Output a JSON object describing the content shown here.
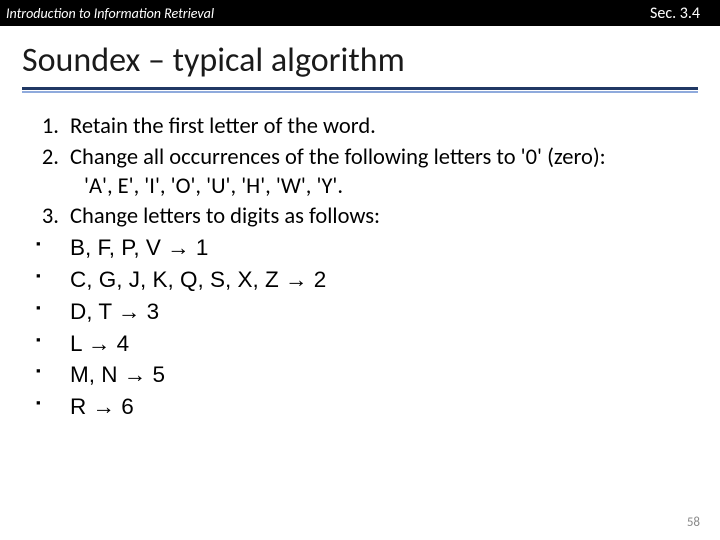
{
  "header": {
    "course": "Introduction to Information Retrieval",
    "section": "Sec. 3.4"
  },
  "title": "Soundex – typical algorithm",
  "steps": {
    "s1": "Retain the first letter of the word.",
    "s2a": "Change all occurrences of the following letters to '0' (zero):",
    "s2b": "'A', E', 'I', 'O', 'U', 'H', 'W', 'Y'.",
    "s3": "Change letters to digits as follows:"
  },
  "mappings": {
    "m1": "B, F, P, V → 1",
    "m2": "C, G, J, K, Q, S, X, Z → 2",
    "m3": "D, T → 3",
    "m4": "L → 4",
    "m5": "M, N → 5",
    "m6": "R → 6"
  },
  "page_number": "58"
}
